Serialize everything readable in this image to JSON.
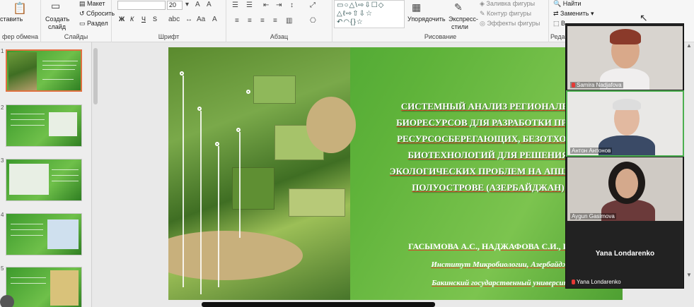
{
  "ribbon": {
    "clipboard": {
      "paste_label": "ставить",
      "group_label": "фер обмена"
    },
    "slides": {
      "new_slide_label": "Создать",
      "new_slide_label2": "слайд",
      "layout_label": "Макет",
      "reset_label": "Сбросить",
      "section_label": "Раздел",
      "group_label": "Слайды"
    },
    "font": {
      "font_name": "",
      "font_size": "20",
      "bold": "Ж",
      "italic": "К",
      "underline": "Ч",
      "strike": "S",
      "group_label": "Шрифт"
    },
    "paragraph": {
      "group_label": "Абзац"
    },
    "drawing": {
      "arrange_label": "Упорядочить",
      "styles_label": "Экспресс-",
      "styles_label2": "стили",
      "fill_label": "Заливка фигуры",
      "outline_label": "Контур фигуры",
      "effects_label": "Эффекты фигуры",
      "group_label": "Рисование"
    },
    "editing": {
      "find_label": "Найти",
      "replace_label": "Заменить",
      "select_label": "В",
      "group_label": "Реда"
    }
  },
  "thumbnails": [
    {
      "number": "1",
      "active": true
    },
    {
      "number": "2",
      "active": false
    },
    {
      "number": "3",
      "active": false
    },
    {
      "number": "4",
      "active": false
    },
    {
      "number": "5",
      "active": false
    }
  ],
  "slide": {
    "title_lines": [
      "СИСТЕМНЫЙ АНАЛИЗ РЕГИОНАЛЬН",
      "БИОРЕСУРСОВ ДЛЯ РАЗРАБОТКИ ПРОЕ",
      "РЕСУРСОСБЕРЕГАЮЩИХ, БЕЗОТХОДН",
      "БИОТЕХНОЛОГИЙ ДЛЯ РЕШЕНИЯ",
      "ЭКОЛОГИЧЕСКИХ ПРОБЛЕМ НА АПШЕРО",
      "ПОЛУОСТРОВЕ (АЗЕРБАЙДЖАН)"
    ],
    "authors": "ГАСЫМОВА А.С.,  НАДЖАФОВА С.И.,  ИСМАИ",
    "institution1": "Институт Микробиологии, Азербайджа",
    "institution2": "Бакинский государственный университе"
  },
  "participants": [
    {
      "name": "Samira Nadjafova",
      "muted": true,
      "active": false
    },
    {
      "name": "Антон Антонов",
      "muted": false,
      "active": true
    },
    {
      "name": "Aygun Gasimova",
      "muted": false,
      "active": false
    },
    {
      "name": "Yana Londarenko",
      "muted": true,
      "active": false,
      "no_video": true
    }
  ]
}
